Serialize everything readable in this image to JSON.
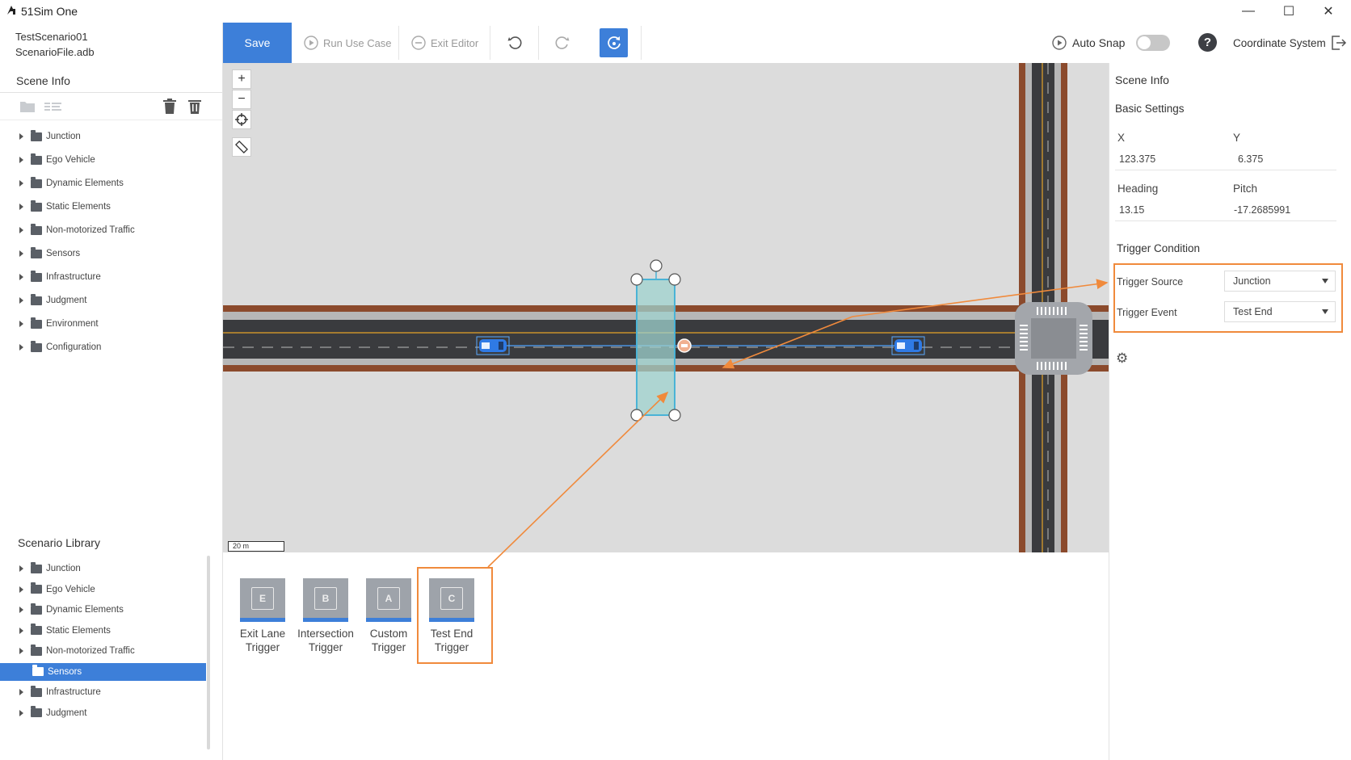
{
  "window": {
    "app_title": "51Sim One",
    "minimize_glyph": "—",
    "maximize_glyph": "☐",
    "close_glyph": "✕"
  },
  "project": {
    "scenario_name": "TestScenario01",
    "file_name": "ScenarioFile.adb"
  },
  "scene_info_panel": {
    "title": "Scene Info",
    "items": [
      {
        "label": "Junction"
      },
      {
        "label": "Ego Vehicle"
      },
      {
        "label": "Dynamic Elements"
      },
      {
        "label": "Static Elements"
      },
      {
        "label": "Non-motorized Traffic"
      },
      {
        "label": "Sensors"
      },
      {
        "label": "Infrastructure"
      },
      {
        "label": "Judgment"
      },
      {
        "label": "Environment"
      },
      {
        "label": "Configuration"
      }
    ]
  },
  "scenario_library": {
    "title": "Scenario Library",
    "selected_index": 5,
    "items": [
      {
        "label": "Junction"
      },
      {
        "label": "Ego Vehicle"
      },
      {
        "label": "Dynamic Elements"
      },
      {
        "label": "Static Elements"
      },
      {
        "label": "Non-motorized Traffic"
      },
      {
        "label": "Sensors"
      },
      {
        "label": "Infrastructure"
      },
      {
        "label": "Judgment"
      }
    ]
  },
  "toolbar": {
    "save_label": "Save",
    "run_use_case_label": "Run Use Case",
    "exit_editor_label": "Exit Editor",
    "auto_snap_label": "Auto Snap",
    "auto_snap_on": false,
    "coordinate_system_label": "Coordinate System",
    "help_glyph": "?"
  },
  "map": {
    "scale_label": "20 m",
    "zoom_in_glyph": "+",
    "zoom_out_glyph": "−"
  },
  "trigger_palette": [
    {
      "label_line1": "Exit Lane",
      "label_line2": "Trigger",
      "glyph": "E"
    },
    {
      "label_line1": "Intersection",
      "label_line2": "Trigger",
      "glyph": "B"
    },
    {
      "label_line1": "Custom",
      "label_line2": "Trigger",
      "glyph": "A"
    },
    {
      "label_line1": "Test End",
      "label_line2": "Trigger",
      "glyph": "C"
    }
  ],
  "right_panel": {
    "title": "Scene Info",
    "basic_settings_title": "Basic Settings",
    "x_label": "X",
    "x_value": "123.375",
    "y_label": "Y",
    "y_value": "6.375",
    "heading_label": "Heading",
    "heading_value": "13.15",
    "pitch_label": "Pitch",
    "pitch_value": "-17.2685991",
    "trigger_condition_title": "Trigger Condition",
    "trigger_source_label": "Trigger Source",
    "trigger_source_value": "Junction",
    "trigger_event_label": "Trigger Event",
    "trigger_event_value": "Test End",
    "settings_glyph": "⚙"
  },
  "colors": {
    "accent": "#3d7fd9",
    "highlight": "#f08a3c",
    "road": "#3a3b3e",
    "road_edge": "#8b4a2c"
  }
}
